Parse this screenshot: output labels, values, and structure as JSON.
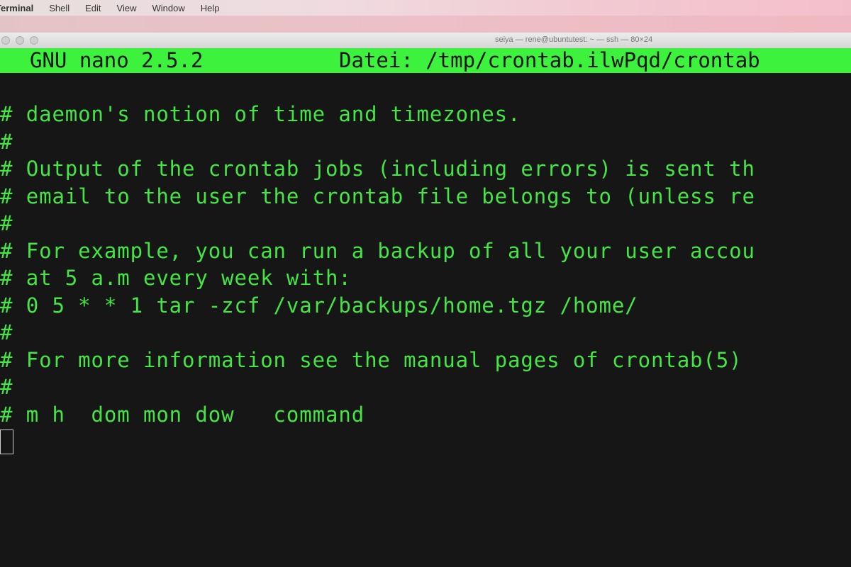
{
  "menubar": {
    "app": "Terminal",
    "items": [
      "Shell",
      "Edit",
      "View",
      "Window",
      "Help"
    ]
  },
  "window": {
    "title": "seiya — rene@ubuntutest: ~ — ssh — 80×24"
  },
  "nano": {
    "version": "GNU nano 2.5.2",
    "file": "Datei: /tmp/crontab.ilwPqd/crontab"
  },
  "editor": {
    "lines": [
      "# daemon's notion of time and timezones.",
      "#",
      "# Output of the crontab jobs (including errors) is sent th",
      "# email to the user the crontab file belongs to (unless re",
      "#",
      "# For example, you can run a backup of all your user accou",
      "# at 5 a.m every week with:",
      "# 0 5 * * 1 tar -zcf /var/backups/home.tgz /home/",
      "#",
      "# For more information see the manual pages of crontab(5)",
      "#",
      "# m h  dom mon dow   command"
    ]
  },
  "colors": {
    "terminal_bg": "#161616",
    "text_green": "#44e544",
    "header_bg": "#3cf23c"
  }
}
